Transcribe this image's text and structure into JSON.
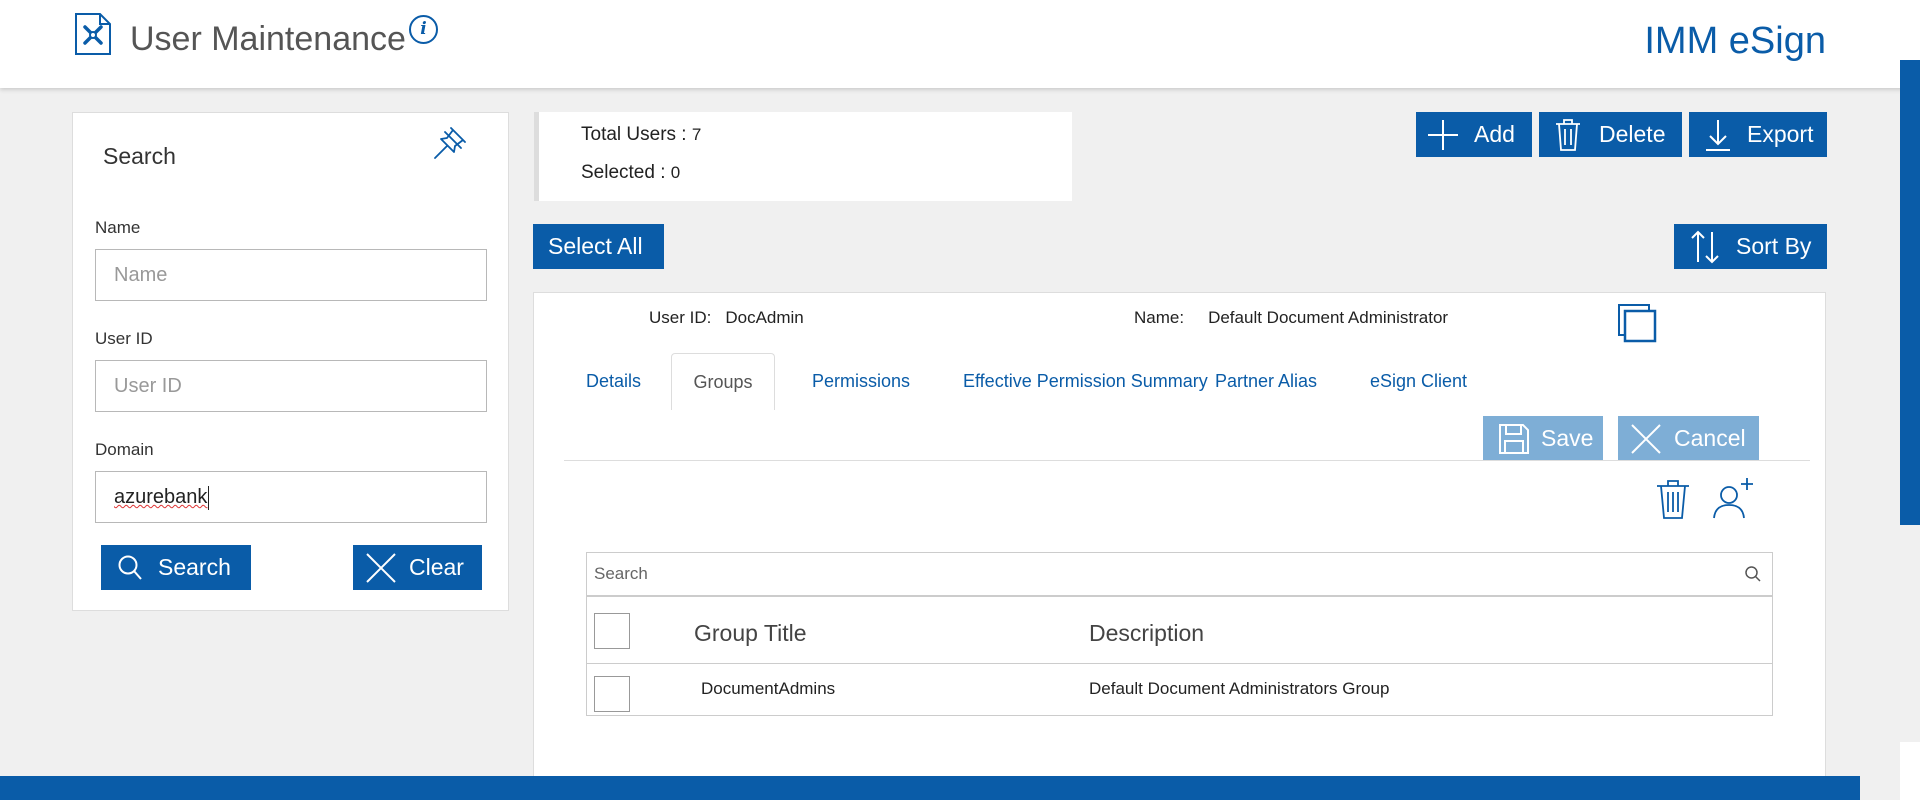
{
  "header": {
    "title": "User Maintenance",
    "info_icon": "i",
    "brand": "IMM eSign"
  },
  "colors": {
    "primary": "#0a5ca8",
    "button_disabled": "#7eaed6",
    "background": "#f0f0f0"
  },
  "search_panel": {
    "title": "Search",
    "fields": {
      "name": {
        "label": "Name",
        "placeholder": "Name",
        "value": ""
      },
      "user_id": {
        "label": "User ID",
        "placeholder": "User ID",
        "value": ""
      },
      "domain": {
        "label": "Domain",
        "value": "azurebank"
      }
    },
    "search_button": "Search",
    "clear_button": "Clear"
  },
  "summary": {
    "total_label": "Total Users : ",
    "total_value": "7",
    "selected_label": "Selected : ",
    "selected_value": "0"
  },
  "toolbar": {
    "add": "Add",
    "delete": "Delete",
    "export": "Export",
    "select_all": "Select All",
    "sort_by": "Sort By"
  },
  "detail": {
    "user_id_label": "User ID:",
    "user_id_value": "DocAdmin",
    "name_label": "Name:",
    "name_value": "Default Document Administrator",
    "tabs": [
      {
        "label": "Details",
        "active": false
      },
      {
        "label": "Groups",
        "active": true
      },
      {
        "label": "Permissions",
        "active": false
      },
      {
        "label": "Effective Permission Summary",
        "active": false
      },
      {
        "label": "Partner Alias",
        "active": false
      },
      {
        "label": "eSign Client",
        "active": false
      }
    ],
    "save": "Save",
    "cancel": "Cancel",
    "grid": {
      "search_placeholder": "Search",
      "columns": [
        "Group Title",
        "Description"
      ],
      "rows": [
        {
          "title": "DocumentAdmins",
          "description": "Default Document Administrators Group"
        }
      ]
    }
  }
}
